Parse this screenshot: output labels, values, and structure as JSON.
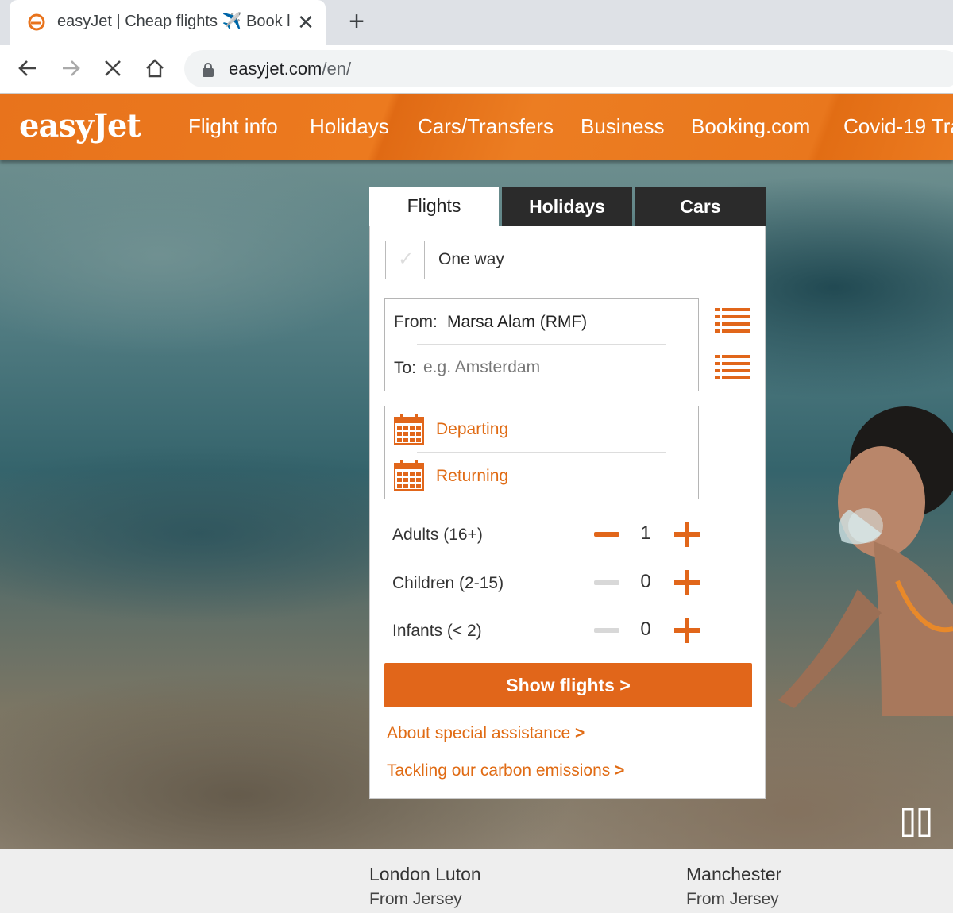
{
  "browser": {
    "tab_title": "easyJet | Cheap flights ✈️ Book l",
    "url_domain": "easyjet.com",
    "url_path": "/en/",
    "tab_close": "✕",
    "new_tab": "+"
  },
  "header": {
    "logo": "easyJet",
    "nav": [
      "Flight info",
      "Holidays",
      "Cars/Transfers",
      "Business",
      "Booking.com",
      "Covid-19 Tra"
    ]
  },
  "booking": {
    "tabs": [
      "Flights",
      "Holidays",
      "Cars"
    ],
    "one_way_label": "One way",
    "from_label": "From:",
    "from_value": "Marsa Alam (RMF)",
    "to_label": "To:",
    "to_placeholder": "e.g. Amsterdam",
    "departing_label": "Departing",
    "returning_label": "Returning",
    "passengers": [
      {
        "label": "Adults (16+)",
        "count": "1"
      },
      {
        "label": "Children (2-15)",
        "count": "0"
      },
      {
        "label": "Infants (< 2)",
        "count": "0"
      }
    ],
    "show_flights_label": "Show flights >",
    "special_assistance_label": "About special assistance",
    "carbon_label": "Tackling our carbon emissions",
    "link_arrow": ">"
  },
  "destinations": [
    {
      "title": "London Luton",
      "subtitle": "From Jersey"
    },
    {
      "title": "Manchester",
      "subtitle": "From Jersey"
    }
  ],
  "colors": {
    "brand_orange": "#e1661a",
    "dark_tab": "#2b2b2b"
  }
}
